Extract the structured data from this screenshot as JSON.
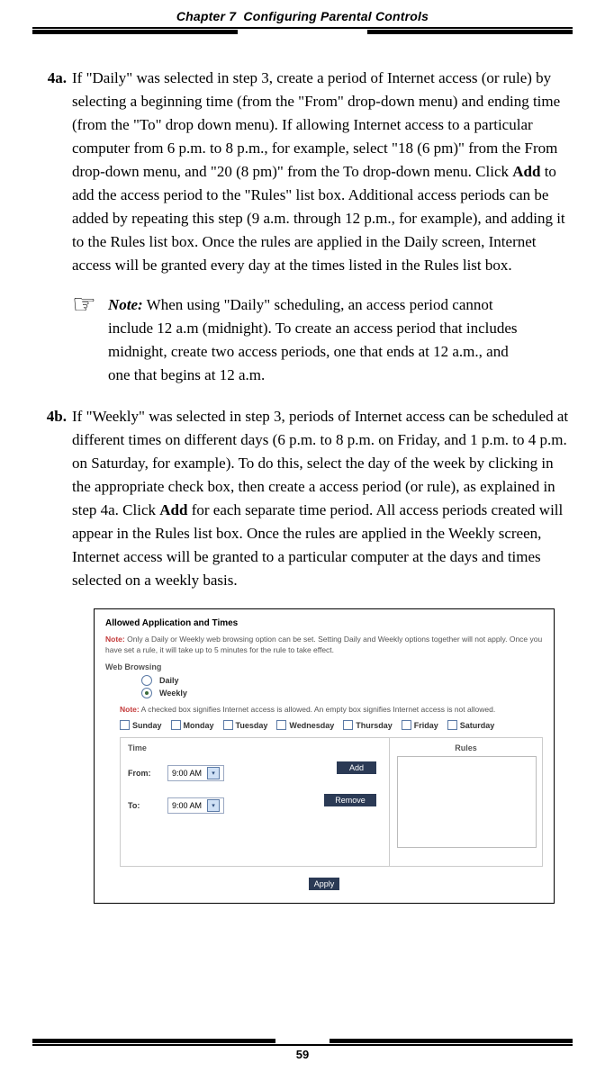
{
  "chapter": {
    "num_label": "Chapter 7",
    "title": "Configuring Parental Controls"
  },
  "steps": {
    "s4a": {
      "num": "4a.",
      "text_pre": "If \"Daily\" was selected in step 3, create a period of Internet access (or rule) by selecting a beginning time (from the \"From\" drop-down menu) and ending time (from the \"To\" drop down menu). If allowing Internet access to a particular computer from 6 p.m. to 8 p.m., for example, select \"18 (6 pm)\" from the From drop-down menu, and \"20 (8 pm)\" from the To drop-down menu. Click ",
      "add_word": "Add",
      "text_post": " to add the access period to the \"Rules\" list box. Additional access periods can be added by repeating this step (9 a.m. through 12 p.m., for example), and adding it to the Rules list box. Once the rules are applied in the Daily screen, Internet access will be granted every day at the times listed in the Rules list box."
    },
    "s4b": {
      "num": "4b.",
      "text_pre": "If \"Weekly\" was selected in step 3, periods of Internet access can be scheduled at different times on different days (6 p.m. to 8 p.m. on Friday, and 1 p.m. to 4 p.m. on Saturday, for example). To do this, select the day of the week by clicking in the appropriate check box, then create a access period (or rule), as explained in step 4a. Click ",
      "add_word": "Add",
      "text_post": " for each separate time period. All access periods created will appear in the Rules list box. Once the rules are applied in the Weekly screen, Internet access will be granted to a particular computer at the days and times selected on a weekly basis."
    }
  },
  "note": {
    "label": "Note:",
    "icon": "☞",
    "text": " When using \"Daily\" scheduling, an access period cannot include 12 a.m (midnight). To create an access period that includes midnight, create two access periods, one that ends at 12 a.m., and one that begins at 12 a.m."
  },
  "screenshot": {
    "title": "Allowed Application and Times",
    "top_note_label": "Note:",
    "top_note_text": " Only a Daily or Weekly web browsing option can be set. Setting Daily and Weekly options together will not apply. Once you have set a rule, it will take up to 5 minutes for the rule to take effect.",
    "web_browsing_label": "Web Browsing",
    "radio_daily": "Daily",
    "radio_weekly": "Weekly",
    "allowed_note_label": "Note:",
    "allowed_note_text": " A checked box signifies Internet access is allowed. An empty box signifies Internet access is not allowed.",
    "days": [
      "Sunday",
      "Monday",
      "Tuesday",
      "Wednesday",
      "Thursday",
      "Friday",
      "Saturday"
    ],
    "time_label": "Time",
    "from_label": "From:",
    "to_label": "To:",
    "time_value": "9:00 AM",
    "add_btn": "Add",
    "remove_btn": "Remove",
    "rules_label": "Rules",
    "apply_btn": "Apply"
  },
  "page_number": "59"
}
